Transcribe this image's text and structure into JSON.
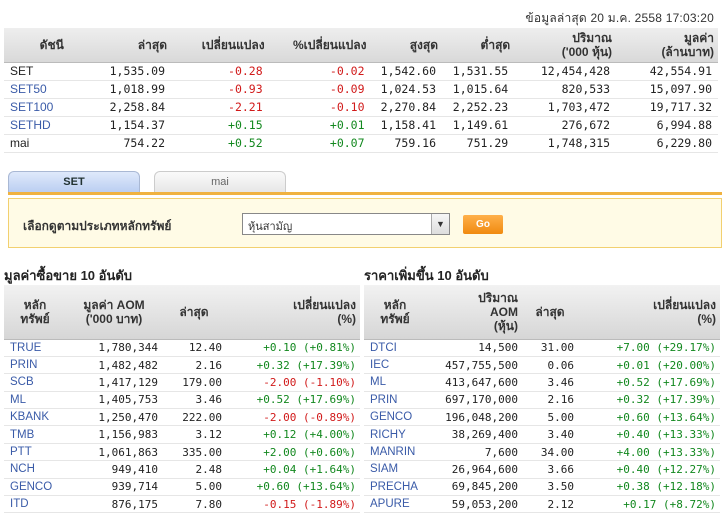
{
  "timestamp": "ข้อมูลล่าสุด 20 ม.ค. 2558 17:03:20",
  "index_table": {
    "headers": [
      "ดัชนี",
      "ล่าสุด",
      "เปลี่ยนแปลง",
      "%เปลี่ยนแปลง",
      "สูงสุด",
      "ต่ำสุด",
      "ปริมาณ\n('000 หุ้น)",
      "มูลค่า\n(ล้านบาท)"
    ],
    "header_h1": "ดัชนี",
    "header_h2": "ล่าสุด",
    "header_h3": "เปลี่ยนแปลง",
    "header_h4": "%เปลี่ยนแปลง",
    "header_h5": "สูงสุด",
    "header_h6": "ต่ำสุด",
    "header_h7a": "ปริมาณ",
    "header_h7b": "('000 หุ้น)",
    "header_h8a": "มูลค่า",
    "header_h8b": "(ล้านบาท)",
    "rows": [
      {
        "name": "SET",
        "last": "1,535.09",
        "chg": "-0.28",
        "pct": "-0.02",
        "high": "1,542.60",
        "low": "1,531.55",
        "vol": "12,454,428",
        "val": "42,554.91"
      },
      {
        "name": "SET50",
        "last": "1,018.99",
        "chg": "-0.93",
        "pct": "-0.09",
        "high": "1,024.53",
        "low": "1,015.64",
        "vol": "820,533",
        "val": "15,097.90"
      },
      {
        "name": "SET100",
        "last": "2,258.84",
        "chg": "-2.21",
        "pct": "-0.10",
        "high": "2,270.84",
        "low": "2,252.23",
        "vol": "1,703,472",
        "val": "19,717.32"
      },
      {
        "name": "SETHD",
        "last": "1,154.37",
        "chg": "+0.15",
        "pct": "+0.01",
        "high": "1,158.41",
        "low": "1,149.61",
        "vol": "276,672",
        "val": "6,994.88"
      },
      {
        "name": "mai",
        "last": "754.22",
        "chg": "+0.52",
        "pct": "+0.07",
        "high": "759.16",
        "low": "751.29",
        "vol": "1,748,315",
        "val": "6,229.80"
      }
    ]
  },
  "tabs": {
    "set": "SET",
    "mai": "mai"
  },
  "selector": {
    "label": "เลือกดูตามประเภทหลักทรัพย์",
    "selected": "หุ้นสามัญ",
    "go": "Go"
  },
  "left_section": {
    "title": "มูลค่าซื้อขาย 10 อันดับ",
    "h_sym_a": "หลัก",
    "h_sym_b": "ทรัพย์",
    "h_val_a": "มูลค่า AOM",
    "h_val_b": "('000 บาท)",
    "h_last": "ล่าสุด",
    "h_chg_a": "เปลี่ยนแปลง",
    "h_chg_b": "(%)",
    "rows": [
      {
        "sym": "TRUE",
        "val": "1,780,344",
        "last": "12.40",
        "chg": "+0.10 (+0.81%)",
        "dir": "pos"
      },
      {
        "sym": "PRIN",
        "val": "1,482,482",
        "last": "2.16",
        "chg": "+0.32 (+17.39%)",
        "dir": "pos"
      },
      {
        "sym": "SCB",
        "val": "1,417,129",
        "last": "179.00",
        "chg": "-2.00 (-1.10%)",
        "dir": "neg"
      },
      {
        "sym": "ML",
        "val": "1,405,753",
        "last": "3.46",
        "chg": "+0.52 (+17.69%)",
        "dir": "pos"
      },
      {
        "sym": "KBANK",
        "val": "1,250,470",
        "last": "222.00",
        "chg": "-2.00 (-0.89%)",
        "dir": "neg"
      },
      {
        "sym": "TMB",
        "val": "1,156,983",
        "last": "3.12",
        "chg": "+0.12 (+4.00%)",
        "dir": "pos"
      },
      {
        "sym": "PTT",
        "val": "1,061,863",
        "last": "335.00",
        "chg": "+2.00 (+0.60%)",
        "dir": "pos"
      },
      {
        "sym": "NCH",
        "val": "949,410",
        "last": "2.48",
        "chg": "+0.04 (+1.64%)",
        "dir": "pos"
      },
      {
        "sym": "GENCO",
        "val": "939,714",
        "last": "5.00",
        "chg": "+0.60 (+13.64%)",
        "dir": "pos"
      },
      {
        "sym": "ITD",
        "val": "876,175",
        "last": "7.80",
        "chg": "-0.15 (-1.89%)",
        "dir": "neg"
      }
    ]
  },
  "right_section": {
    "title": "ราคาเพิ่มขึ้น 10 อันดับ",
    "h_sym_a": "หลัก",
    "h_sym_b": "ทรัพย์",
    "h_vol_a": "ปริมาณ",
    "h_vol_b": "AOM",
    "h_vol_c": "(หุ้น)",
    "h_last": "ล่าสุด",
    "h_chg_a": "เปลี่ยนแปลง",
    "h_chg_b": "(%)",
    "rows": [
      {
        "sym": "DTCI",
        "vol": "14,500",
        "last": "31.00",
        "chg": "+7.00 (+29.17%)",
        "dir": "pos"
      },
      {
        "sym": "IEC",
        "vol": "457,755,500",
        "last": "0.06",
        "chg": "+0.01 (+20.00%)",
        "dir": "pos"
      },
      {
        "sym": "ML",
        "vol": "413,647,600",
        "last": "3.46",
        "chg": "+0.52 (+17.69%)",
        "dir": "pos"
      },
      {
        "sym": "PRIN",
        "vol": "697,170,000",
        "last": "2.16",
        "chg": "+0.32 (+17.39%)",
        "dir": "pos"
      },
      {
        "sym": "GENCO",
        "vol": "196,048,200",
        "last": "5.00",
        "chg": "+0.60 (+13.64%)",
        "dir": "pos"
      },
      {
        "sym": "RICHY",
        "vol": "38,269,400",
        "last": "3.40",
        "chg": "+0.40 (+13.33%)",
        "dir": "pos"
      },
      {
        "sym": "MANRIN",
        "vol": "7,600",
        "last": "34.00",
        "chg": "+4.00 (+13.33%)",
        "dir": "pos"
      },
      {
        "sym": "SIAM",
        "vol": "26,964,600",
        "last": "3.66",
        "chg": "+0.40 (+12.27%)",
        "dir": "pos"
      },
      {
        "sym": "PRECHA",
        "vol": "69,845,200",
        "last": "3.50",
        "chg": "+0.38 (+12.18%)",
        "dir": "pos"
      },
      {
        "sym": "APURE",
        "vol": "59,053,200",
        "last": "2.12",
        "chg": "+0.17 (+8.72%)",
        "dir": "pos"
      }
    ]
  },
  "colors": {
    "negative": "#d11a1a",
    "positive": "#12881e",
    "link": "#3a5ba8",
    "accent": "#f0b240"
  }
}
